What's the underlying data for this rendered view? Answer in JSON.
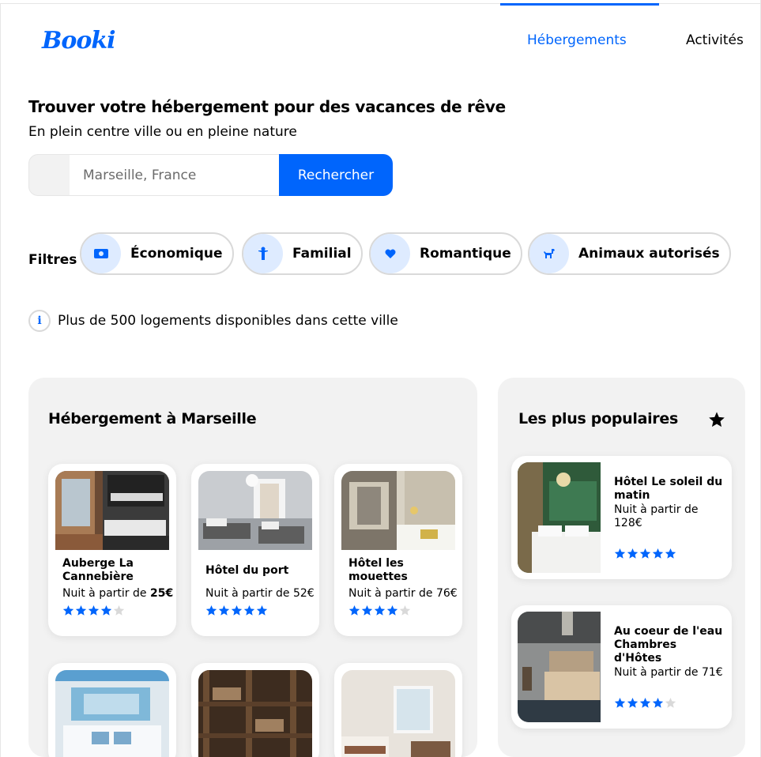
{
  "brand": {
    "logo_text": "Booki",
    "accent_color": "#0065FC",
    "panel_color": "#F2F2F2",
    "star_inactive_color": "#D9D9D9"
  },
  "nav": {
    "items": [
      {
        "label": "Hébergements",
        "active": true
      },
      {
        "label": "Activités",
        "active": false
      }
    ]
  },
  "hero": {
    "title": "Trouver votre hébergement pour des vacances de rêve",
    "subtitle": "En plein centre ville ou en pleine nature"
  },
  "search": {
    "placeholder": "Marseille, France",
    "value": "",
    "button_label": "Rechercher"
  },
  "filters": {
    "label": "Filtres",
    "items": [
      {
        "label": "Économique",
        "icon": "money-icon"
      },
      {
        "label": "Familial",
        "icon": "child-icon"
      },
      {
        "label": "Romantique",
        "icon": "heart-icon"
      },
      {
        "label": "Animaux autorisés",
        "icon": "dog-icon"
      }
    ]
  },
  "info": {
    "text": "Plus de 500 logements disponibles dans cette ville",
    "icon": "info-icon"
  },
  "lodgings": {
    "title": "Hébergement à Marseille",
    "cards": [
      {
        "name": "Auberge La Cannebière",
        "price_prefix": "Nuit à partir de ",
        "price": "25€",
        "rating": 4
      },
      {
        "name": "Hôtel du port",
        "price_prefix": "Nuit à partir de ",
        "price": "52€",
        "rating": 5
      },
      {
        "name": "Hôtel les mouettes",
        "price_prefix": "Nuit à partir de ",
        "price": "76€",
        "rating": 4
      }
    ]
  },
  "popular": {
    "title": "Les plus populaires",
    "icon": "star-icon",
    "cards": [
      {
        "name": "Hôtel Le soleil du matin",
        "price_prefix": "Nuit à partir de ",
        "price": "128€",
        "rating": 5
      },
      {
        "name": "Au coeur de l'eau Chambres d'Hôtes",
        "price_prefix": "Nuit à partir de ",
        "price": "71€",
        "rating": 4
      }
    ]
  }
}
